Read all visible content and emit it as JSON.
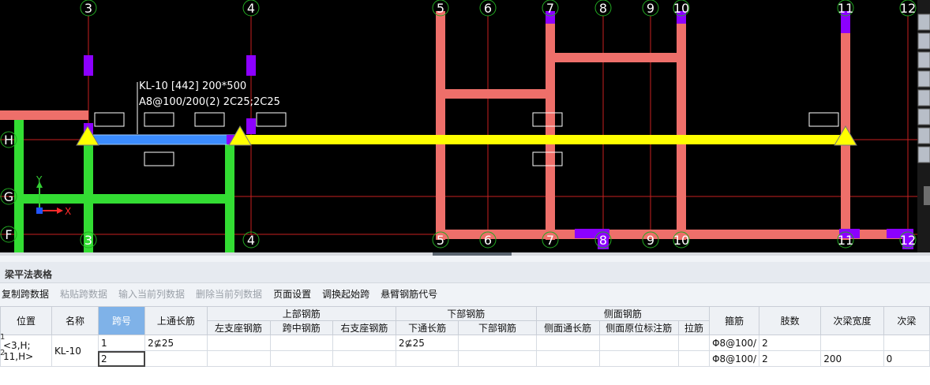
{
  "grid_top": [
    "3",
    "4",
    "5",
    "6",
    "7",
    "8",
    "9",
    "10",
    "11",
    "12"
  ],
  "grid_bottom": [
    "3",
    "4",
    "5",
    "6",
    "7",
    "8",
    "9",
    "10",
    "11",
    "12"
  ],
  "grid_left": [
    "H",
    "G",
    "F"
  ],
  "beam_annotation": {
    "line1": "KL-10 [442] 200*500",
    "line2": "A8@100/200(2) 2C25;2C25"
  },
  "axes": {
    "x": "X",
    "y": "Y"
  },
  "panel": {
    "title": "梁平法表格",
    "toolbar": [
      "复制跨数据",
      "粘贴跨数据",
      "输入当前列数据",
      "删除当前列数据",
      "页面设置",
      "调换起始跨",
      "悬臂钢筋代号"
    ]
  },
  "table": {
    "headers": {
      "position": "位置",
      "name": "名称",
      "span": "跨号",
      "top_through": "上通长筋",
      "top_rebar": "上部钢筋",
      "left_support": "左支座钢筋",
      "mid_span": "跨中钢筋",
      "right_support": "右支座钢筋",
      "bottom_rebar": "下部钢筋",
      "bottom_through": "下通长筋",
      "bottom_bars": "下部钢筋",
      "side_rebar": "侧面钢筋",
      "side_through": "侧面通长筋",
      "side_original": "侧面原位标注筋",
      "tie": "拉筋",
      "stirrup": "箍筋",
      "legs": "肢数",
      "sec_width": "次梁宽度",
      "sec_more": "次梁"
    },
    "row_indicator": [
      "1",
      "2"
    ],
    "position_value": "<3,H;\n11,H>",
    "position_line1": "<3,H;",
    "position_line2": "11,H>",
    "name_value": "KL-10",
    "rows": [
      {
        "span": "1",
        "top_through": "2⊈25",
        "bottom_through": "2⊈25",
        "stirrup": "Φ8@100/",
        "legs": "2",
        "sec_width": "",
        "sec_more": ""
      },
      {
        "span": "2",
        "top_through": "",
        "bottom_through": "",
        "stirrup": "Φ8@100/",
        "legs": "2",
        "sec_width": "200",
        "sec_more": "0"
      }
    ]
  },
  "colors": {
    "canvas_bg": "#000000",
    "grid_line": "#cc2222",
    "red_beam": "#ee6f6a",
    "green_beam": "#33dd33",
    "yellow_beam": "#ffff00",
    "blue_beam": "#3b8cff",
    "column": "#8c00ff"
  }
}
